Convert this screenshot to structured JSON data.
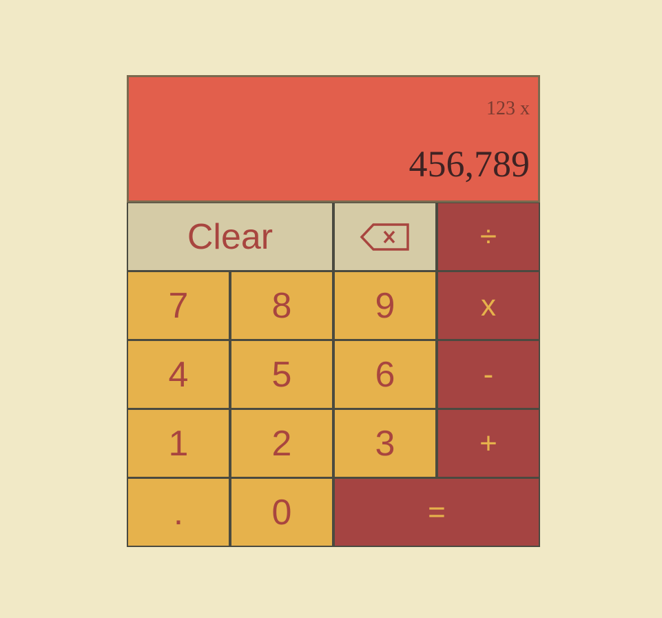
{
  "display": {
    "previous": "123 x",
    "current": "456,789"
  },
  "keys": {
    "clear": "Clear",
    "backspace_icon": "backspace-icon",
    "divide": "÷",
    "multiply": "x",
    "subtract": "-",
    "add": "+",
    "equals": "=",
    "decimal": ".",
    "d0": "0",
    "d1": "1",
    "d2": "2",
    "d3": "3",
    "d4": "4",
    "d5": "5",
    "d6": "6",
    "d7": "7",
    "d8": "8",
    "d9": "9"
  },
  "colors": {
    "page_background": "#f1e9c6",
    "display_background": "#e25f4c",
    "number_key": "#e6b24c",
    "function_key": "#d5cba6",
    "operator_key": "#a54442",
    "key_text": "#a8453f"
  }
}
